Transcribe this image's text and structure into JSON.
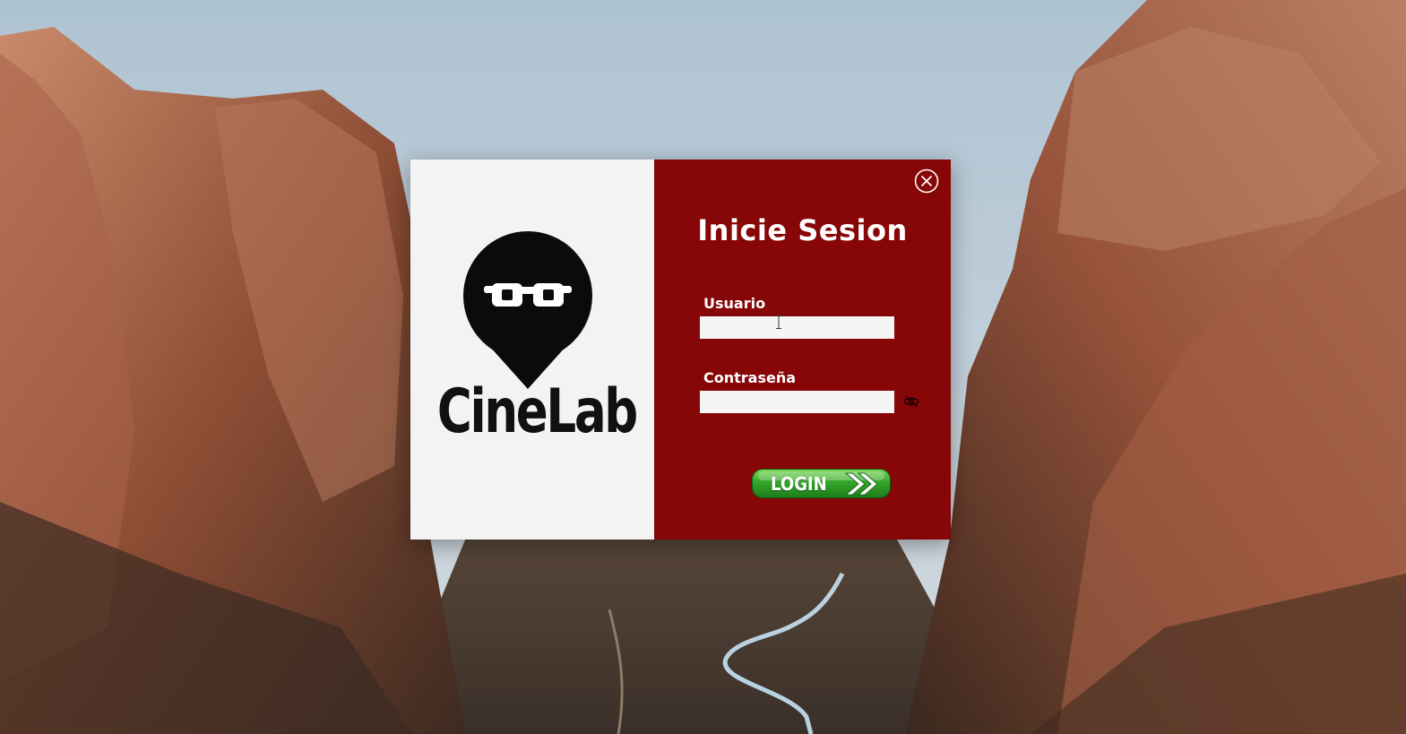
{
  "app": {
    "brand_name": "CineLab",
    "logo_icon": "glasses-pin-logo"
  },
  "form": {
    "title": "Inicie Sesion",
    "username": {
      "label": "Usuario",
      "value": "",
      "placeholder": ""
    },
    "password": {
      "label": "Contraseña",
      "value": "",
      "placeholder": "",
      "toggle_icon": "eye-hidden-icon"
    },
    "login_button": {
      "label": "LOGIN",
      "icon": "double-chevron-right-icon"
    },
    "close_icon": "close-circle-icon"
  },
  "colors": {
    "form_panel": "#870607",
    "brand_panel": "#f3f3f4",
    "login_button": "#35a52a",
    "text_on_red": "#ffffff"
  }
}
